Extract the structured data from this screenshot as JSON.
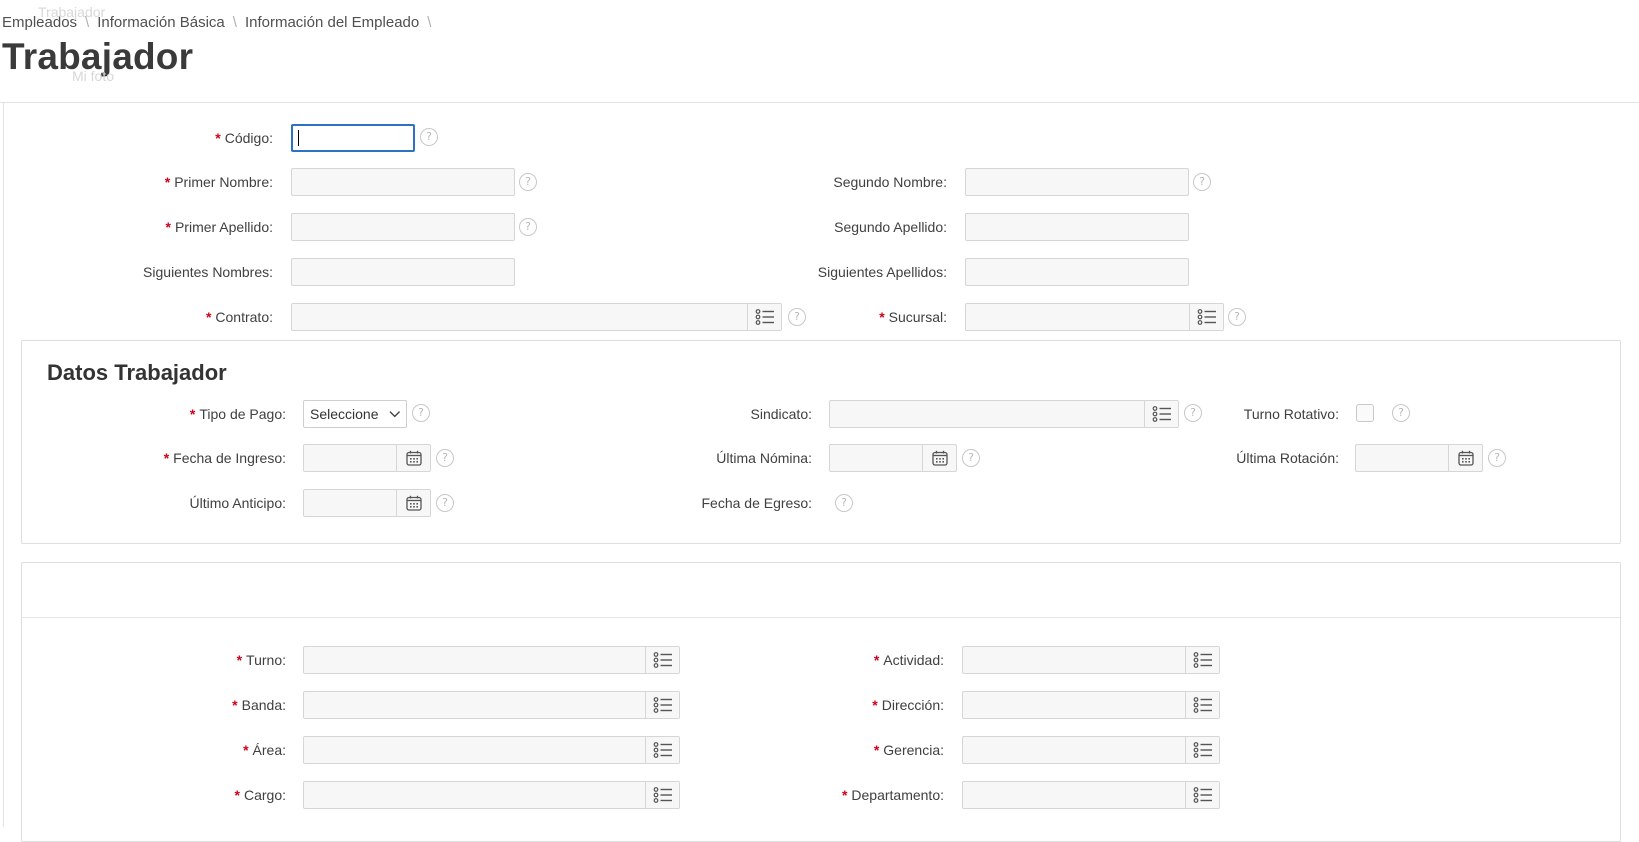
{
  "breadcrumb": {
    "items": [
      "Empleados",
      "Información Básica",
      "Información del Empleado"
    ],
    "ghost_text": "Trabajador"
  },
  "page_title": "Trabajador",
  "photo_alt": "Mi foto",
  "colors": {
    "required": "#d0021b",
    "focus": "#2f72c4"
  },
  "form": {
    "codigo": {
      "label": "Código:",
      "value": ""
    },
    "primer_nombre": {
      "label": "Primer Nombre:",
      "value": ""
    },
    "segundo_nombre": {
      "label": "Segundo Nombre:",
      "value": ""
    },
    "primer_apellido": {
      "label": "Primer Apellido:",
      "value": ""
    },
    "segundo_apellido": {
      "label": "Segundo Apellido:",
      "value": ""
    },
    "siguientes_nombres": {
      "label": "Siguientes Nombres:",
      "value": ""
    },
    "siguientes_apellidos": {
      "label": "Siguientes Apellidos:",
      "value": ""
    },
    "contrato": {
      "label": "Contrato:",
      "value": ""
    },
    "sucursal": {
      "label": "Sucursal:",
      "value": ""
    }
  },
  "datos_trabajador": {
    "title": "Datos Trabajador",
    "tipo_pago": {
      "label": "Tipo de Pago:",
      "selected": "Seleccione"
    },
    "sindicato": {
      "label": "Sindicato:",
      "value": ""
    },
    "turno_rotativo": {
      "label": "Turno Rotativo:",
      "checked": false
    },
    "fecha_ingreso": {
      "label": "Fecha de Ingreso:",
      "value": ""
    },
    "ultima_nomina": {
      "label": "Última Nómina:",
      "value": ""
    },
    "ultima_rotacion": {
      "label": "Última Rotación:",
      "value": ""
    },
    "ultimo_anticipo": {
      "label": "Último Anticipo:",
      "value": ""
    },
    "fecha_egreso": {
      "label": "Fecha de Egreso:"
    }
  },
  "organizacion": {
    "turno": {
      "label": "Turno:",
      "value": ""
    },
    "actividad": {
      "label": "Actividad:",
      "value": ""
    },
    "banda": {
      "label": "Banda:",
      "value": ""
    },
    "direccion": {
      "label": "Dirección:",
      "value": ""
    },
    "area": {
      "label": "Área:",
      "value": ""
    },
    "gerencia": {
      "label": "Gerencia:",
      "value": ""
    },
    "cargo": {
      "label": "Cargo:",
      "value": ""
    },
    "departamento": {
      "label": "Departamento:",
      "value": ""
    }
  },
  "icons": {
    "help": "?",
    "required": "*"
  }
}
